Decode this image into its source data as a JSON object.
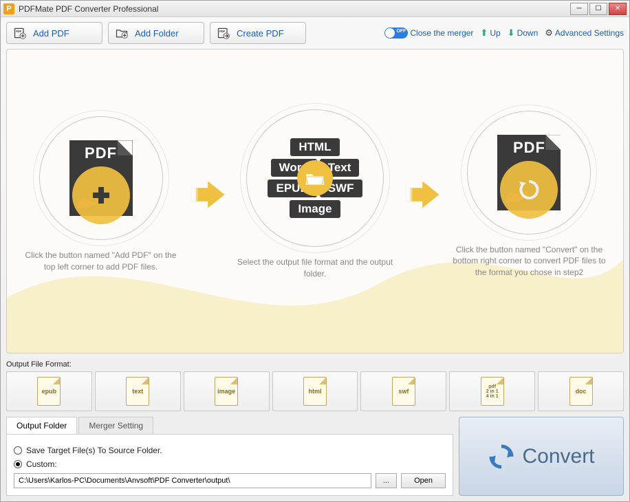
{
  "title": "PDFMate PDF Converter Professional",
  "toolbar": {
    "add_pdf": "Add PDF",
    "add_folder": "Add Folder",
    "create_pdf": "Create PDF"
  },
  "right": {
    "close_merger": "Close the merger",
    "up": "Up",
    "down": "Down",
    "advanced": "Advanced Settings",
    "toggle_label": "OFF"
  },
  "steps": {
    "s1": "Click the button named \"Add PDF\" on the top left corner to add PDF files.",
    "s2": "Select the output file format and the output folder.",
    "s3": "Click the button named \"Convert\" on the bottom right corner to convert PDF files to the format you chose in step2"
  },
  "center_tags": {
    "html": "HTML",
    "word": "Word",
    "text": "Text",
    "epub": "EPUB",
    "swf": "SWF",
    "image": "Image"
  },
  "pdf_label": "PDF",
  "fmt_label": "Output File Format:",
  "formats": [
    "epub",
    "text",
    "image",
    "html",
    "swf",
    "pdf\n2 in 1\n4 in 1",
    "doc"
  ],
  "tabs": {
    "output": "Output Folder",
    "merger": "Merger Setting"
  },
  "panel": {
    "save_source": "Save Target File(s) To Source Folder.",
    "custom": "Custom:",
    "path": "C:\\Users\\Karlos-PC\\Documents\\Anvsoft\\PDF Converter\\output\\",
    "browse": "...",
    "open": "Open"
  },
  "convert": "Convert"
}
